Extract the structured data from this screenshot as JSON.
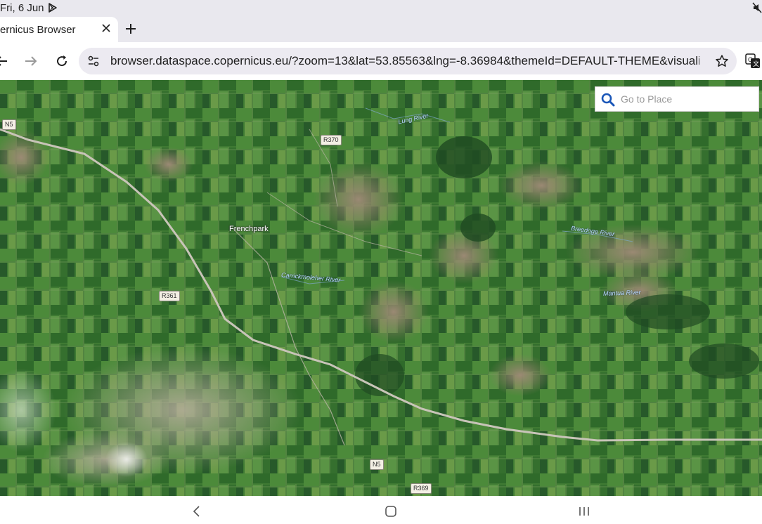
{
  "status_bar": {
    "time": "Fri, 6 Jun",
    "icons": [
      "play-store-icon",
      "mute-icon"
    ]
  },
  "tab": {
    "title": "ernicus Browser",
    "close_icon": "close-icon"
  },
  "toolbar": {
    "url": "browser.dataspace.copernicus.eu/?zoom=13&lat=53.85563&lng=-8.36984&themeId=DEFAULT-THEME&visualizati",
    "icons": [
      "back-icon",
      "forward-icon",
      "reload-icon",
      "site-info-icon",
      "bookmark-star-icon",
      "translate-icon"
    ]
  },
  "map": {
    "search_placeholder": "Go to Place",
    "places": [
      {
        "name": "Frenchpark"
      }
    ],
    "rivers": [
      {
        "name": "Lung River"
      },
      {
        "name": "Breedoge River"
      },
      {
        "name": "Carrickmoleher River"
      },
      {
        "name": "Mantua River"
      }
    ],
    "road_shields": [
      "N5",
      "R370",
      "R361",
      "N5",
      "R369"
    ]
  },
  "nav_bar": {
    "icons": [
      "back-nav-icon",
      "home-nav-icon",
      "recents-nav-icon"
    ]
  },
  "colors": {
    "omnibox_bg": "#eceaf1",
    "chrome_bg": "#e9e8ee",
    "accent": "#1a56b8"
  }
}
